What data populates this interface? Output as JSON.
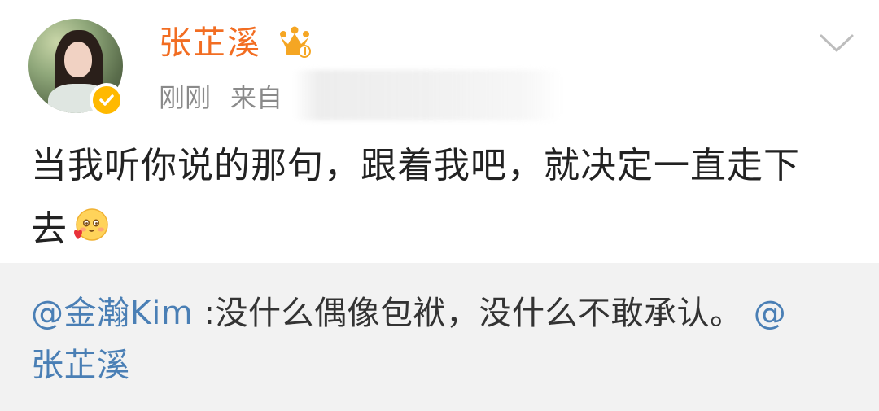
{
  "post": {
    "username": "张芷溪",
    "time": "刚刚",
    "source_prefix": "来自",
    "content_line1": "当我听你说的那句，跟着我吧，就决定一直走下",
    "content_line2": "去",
    "emoji_name": "blush-heart-emoji",
    "icons": {
      "verify": "verified-badge-icon",
      "crown": "crown-member-icon",
      "menu": "chevron-down-icon"
    }
  },
  "quoted": {
    "mention_author": "@金瀚Kim",
    "text": " :没什么偶像包袱，没什么不敢承认。",
    "mention_end_line1": "@",
    "mention_end_line2": "张芷溪"
  },
  "colors": {
    "username": "#f26d22",
    "mention": "#4a7fb5",
    "meta": "#8a8a8a",
    "quoted_bg": "#f2f2f2",
    "verify_badge": "#ffb900"
  }
}
